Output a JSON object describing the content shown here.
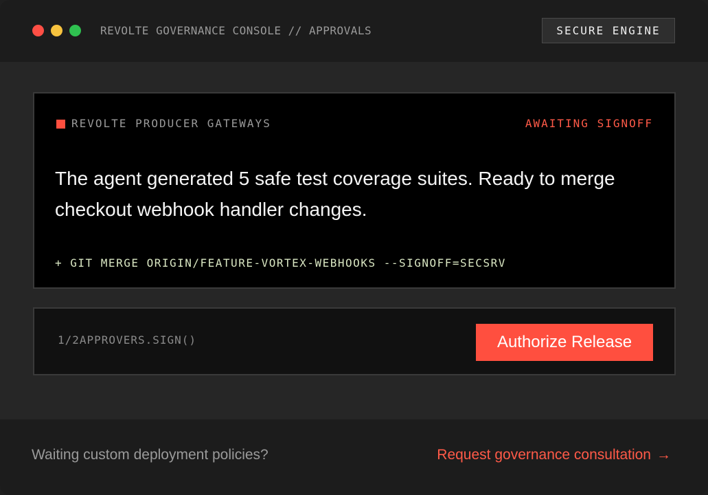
{
  "window": {
    "controls": [
      "close",
      "minimize",
      "maximize"
    ],
    "breadcrumb": "REVOLTE GOVERNANCE CONSOLE // APPROVALS",
    "badge": "SECURE ENGINE"
  },
  "card": {
    "gateway_label": "REVOLTE PRODUCER GATEWAYS",
    "status": "AWAITING SIGNOFF",
    "message": "The agent generated 5 safe test coverage suites. Ready to merge checkout webhook handler changes.",
    "command": "+ GIT MERGE ORIGIN/FEATURE-VORTEX-WEBHOOKS --SIGNOFF=SECSRV"
  },
  "approval": {
    "signers": "1/2APPROVERS.SIGN()",
    "button_label": "Authorize Release"
  },
  "footer": {
    "prompt": "Waiting custom deployment policies?",
    "link_label": "Request governance consultation",
    "link_arrow": "→"
  },
  "colors": {
    "accent": "#ff4f3f",
    "command_text": "#d9e6c2",
    "dot_red": "#ff4f45",
    "dot_yellow": "#f7c33f",
    "dot_green": "#2fc150"
  }
}
